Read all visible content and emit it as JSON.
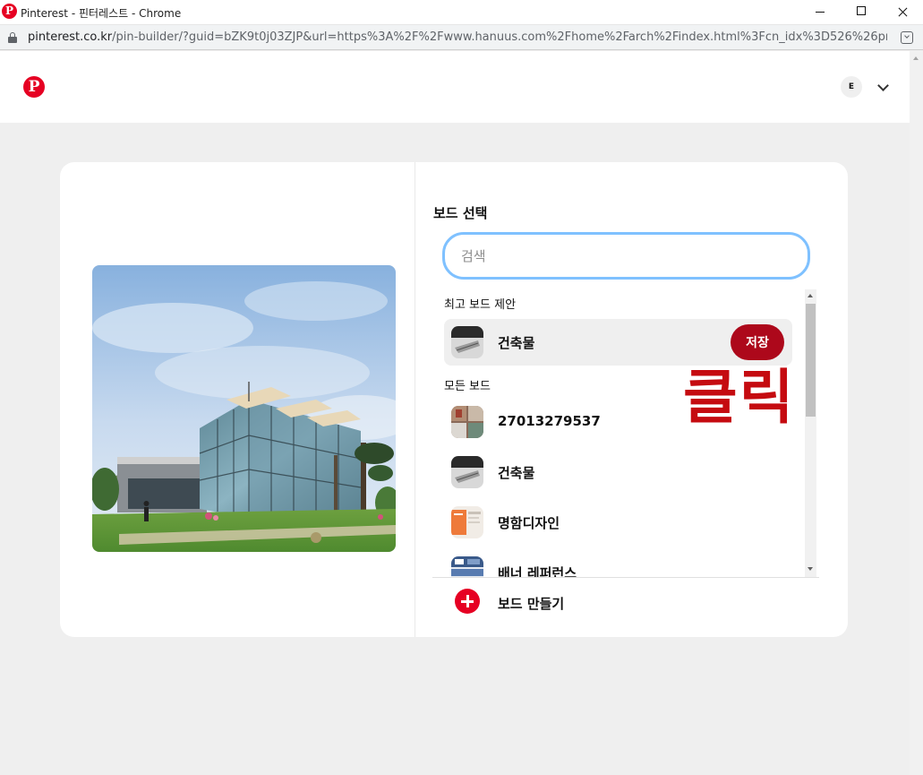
{
  "window": {
    "title": "Pinterest - 핀터레스트 - Chrome",
    "favicon_letter": "P"
  },
  "address_bar": {
    "host": "pinterest.co.kr",
    "path": "/pin-builder/?guid=bZK9t0j03ZJP&url=https%3A%2F%2Fwww.hanuus.com%2Fhome%2Farch%2Findex.html%3Fcn_idx%3D526%26pmo..."
  },
  "header": {
    "logo_letter": "P",
    "avatar_initial": "E",
    "icons": [
      "pinterest-logo-icon",
      "chevron-down-icon"
    ]
  },
  "pin": {
    "image": "glass-building-photo"
  },
  "board_picker": {
    "title": "보드 선택",
    "search_placeholder": "검색",
    "top_suggestion_label": "최고 보드 제안",
    "top_suggestion": {
      "name": "건축물",
      "save_label": "저장"
    },
    "all_boards_label": "모든 보드",
    "boards": [
      {
        "name": "27013279537",
        "thumb": "photo-collage"
      },
      {
        "name": "건축물",
        "thumb": "building-sketch"
      },
      {
        "name": "명함디자인",
        "thumb": "orange-card"
      },
      {
        "name": "배너 레퍼런스",
        "thumb": "banner"
      }
    ],
    "create_label": "보드 만들기"
  },
  "annotation": {
    "text": "클릭",
    "color": "#c50b10"
  },
  "colors": {
    "pinterest_red": "#e60023",
    "save_button": "#ad081b",
    "search_focus": "#7fc1ff",
    "page_bg": "#efefef"
  }
}
